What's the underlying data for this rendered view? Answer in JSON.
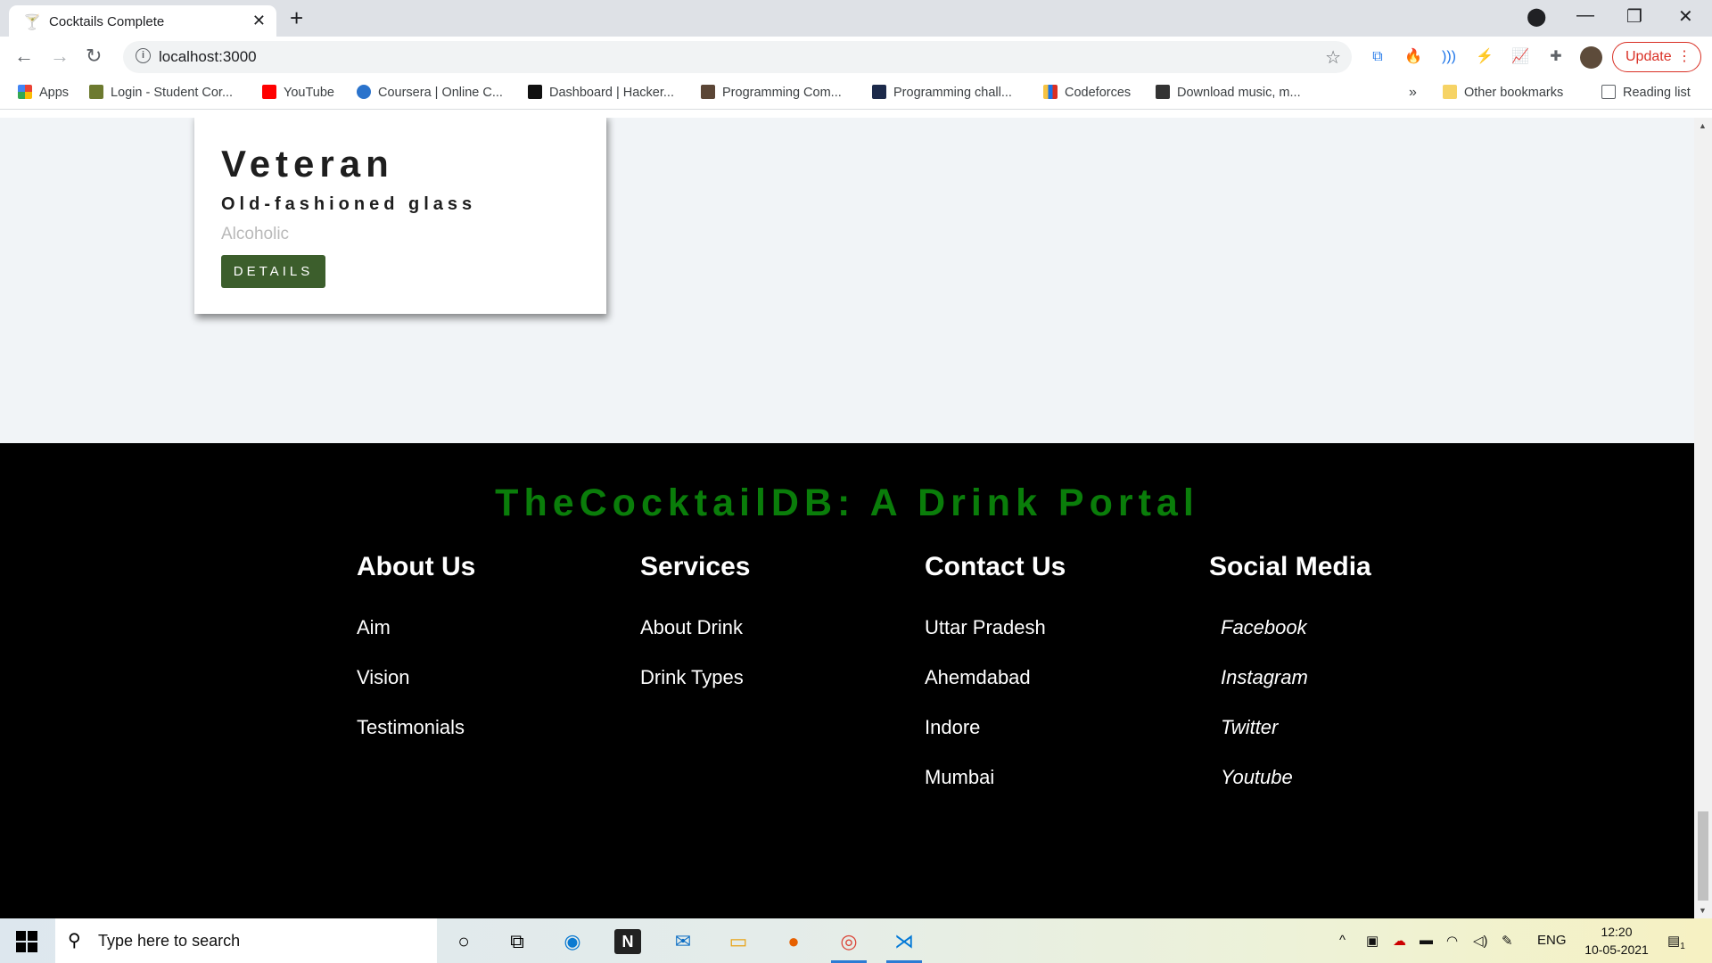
{
  "browser": {
    "tab_title": "Cocktails Complete",
    "new_tab": "+",
    "url": "localhost:3000",
    "update_label": "Update",
    "bookmarks": [
      {
        "label": "Apps",
        "color": "#ea4335"
      },
      {
        "label": "Login - Student Cor...",
        "color": "#6d7a2f"
      },
      {
        "label": "YouTube",
        "color": "#ff0000"
      },
      {
        "label": "Coursera | Online C...",
        "color": "#2a73cc"
      },
      {
        "label": "Dashboard | Hacker...",
        "color": "#111111"
      },
      {
        "label": "Programming Com...",
        "color": "#5b4636"
      },
      {
        "label": "Programming chall...",
        "color": "#1c2a4a"
      },
      {
        "label": "Codeforces",
        "color": "#f6c342"
      },
      {
        "label": "Download music, m...",
        "color": "#333333"
      }
    ],
    "overflow": "»",
    "other_bookmarks": "Other bookmarks",
    "reading_list": "Reading list"
  },
  "card": {
    "name": "Veteran",
    "glass": "Old-fashioned glass",
    "info": "Alcoholic",
    "details_label": "DETAILS"
  },
  "footer": {
    "title": "TheCocktailDB: A Drink Portal",
    "title_color": "#0a7d0a",
    "columns": [
      {
        "heading": "About Us",
        "items": [
          "Aim",
          "Vision",
          "Testimonials"
        ]
      },
      {
        "heading": "Services",
        "items": [
          "About Drink",
          "Drink Types"
        ]
      },
      {
        "heading": "Contact Us",
        "items": [
          "Uttar Pradesh",
          "Ahemdabad",
          "Indore",
          "Mumbai"
        ]
      },
      {
        "heading": "Social Media",
        "items": [
          "Facebook",
          "Instagram",
          "Twitter",
          "Youtube"
        ]
      }
    ]
  },
  "taskbar": {
    "search_placeholder": "Type here to search",
    "language": "ENG",
    "time": "12:20",
    "date": "10-05-2021",
    "notification_count": "1"
  }
}
